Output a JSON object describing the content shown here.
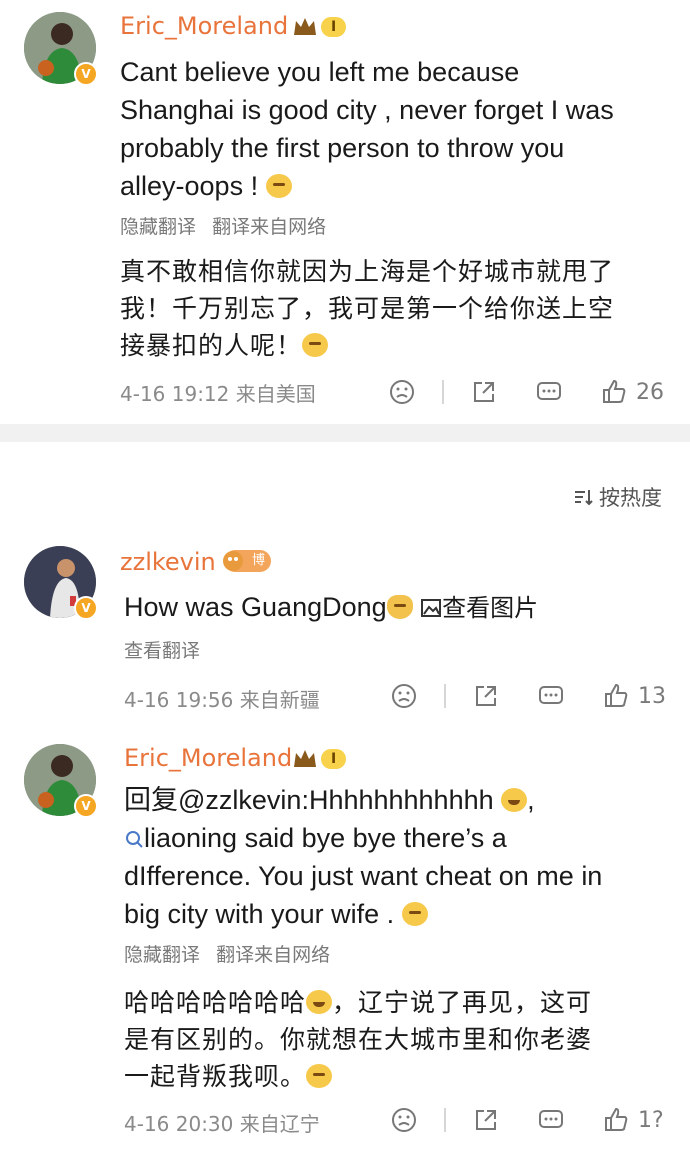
{
  "comments": [
    {
      "username": "Eric_Moreland",
      "level": "I",
      "text_lines": [
        "Cant believe you left me because",
        "Shanghai is good city , never forget I was",
        "probably the first person to throw you",
        "alley-oops !"
      ],
      "hide_translation": "隐藏翻译",
      "translation_source": "翻译来自网络",
      "cn_lines": [
        "真不敢相信你就因为上海是个好城市就甩了",
        "我！千万别忘了，我可是第一个给你送上空",
        "接暴扣的人呢！"
      ],
      "time": "4-16 19:12",
      "location": "来自美国",
      "likes": "26"
    },
    {
      "username": "zzlkevin",
      "badge": "博主",
      "text": "How was GuangDong",
      "view_image": "查看图片",
      "view_translation": "查看翻译",
      "time": "4-16 19:56",
      "location": "来自新疆",
      "likes": "13"
    },
    {
      "username": "Eric_Moreland",
      "level": "I",
      "reply_prefix": "回复@zzlkevin:Hhhhhhhhhhhh",
      "text_lines": [
        "liaoning  said bye bye there’s a",
        "dIfference. You just want cheat on me in",
        "big city with your wife ."
      ],
      "hide_translation": "隐藏翻译",
      "translation_source": "翻译来自网络",
      "cn_lines": [
        "哈哈哈哈哈哈哈",
        "，辽宁说了再见，这可",
        "是有区别的。你就想在大城市里和你老婆",
        "一起背叛我呗。"
      ],
      "time": "4-16 20:30",
      "location": "来自辽宁",
      "likes": "1?"
    }
  ],
  "sort": {
    "label": "按热度"
  },
  "colors": {
    "username": "#e8743b",
    "meta": "#8a8a8a",
    "divider": "#f1f1f1"
  }
}
